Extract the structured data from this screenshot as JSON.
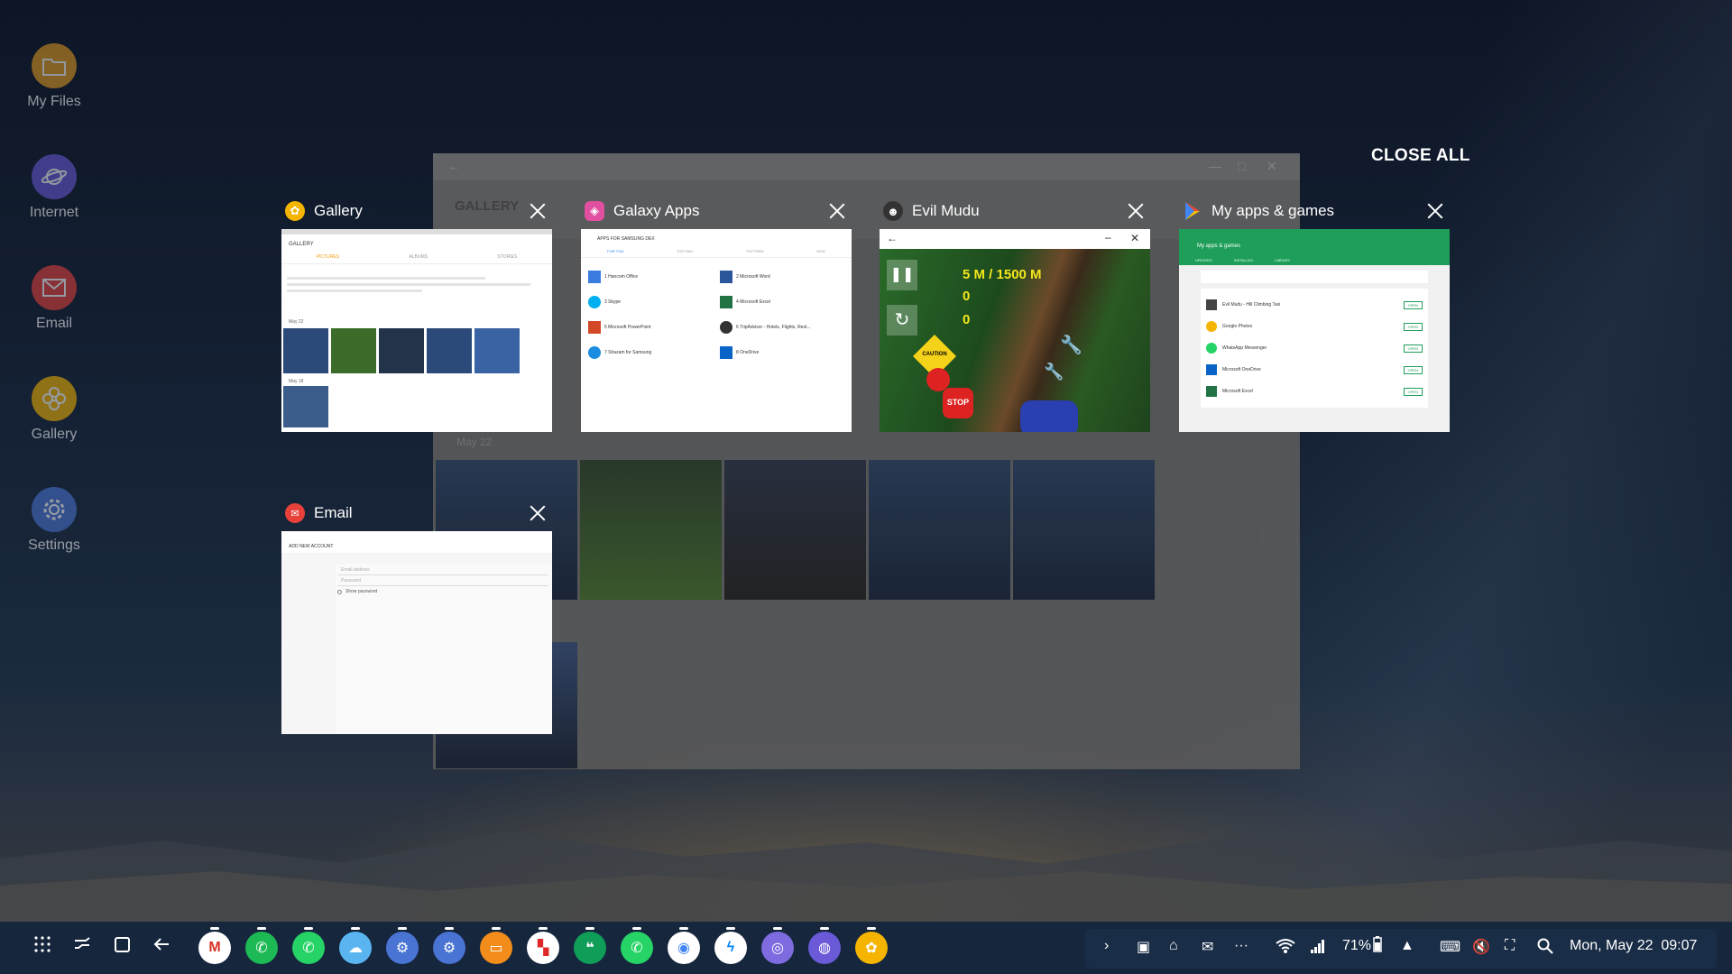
{
  "desktop": {
    "icons": [
      {
        "label": "My Files",
        "icon": "folder-icon",
        "color": "#e39b22"
      },
      {
        "label": "Internet",
        "icon": "planet-icon",
        "color": "#6a5ad8"
      },
      {
        "label": "Email",
        "icon": "envelope-icon",
        "color": "#e8413a"
      },
      {
        "label": "Gallery",
        "icon": "flower-icon",
        "color": "#f4b400"
      },
      {
        "label": "Settings",
        "icon": "gear-icon",
        "color": "#4a74d4"
      }
    ]
  },
  "background_window": {
    "title": "GALLERY",
    "date": "May 22"
  },
  "recents": {
    "close_all_label": "CLOSE ALL",
    "cards": [
      {
        "title": "Gallery",
        "icon": "gallery-icon",
        "color": "#f4b400"
      },
      {
        "title": "Galaxy Apps",
        "icon": "galaxy-apps-icon",
        "color": "#e04fa0"
      },
      {
        "title": "Evil Mudu",
        "icon": "evil-mudu-icon",
        "color": "#333333"
      },
      {
        "title": "My apps & games",
        "icon": "play-store-icon",
        "color": "#ffffff"
      },
      {
        "title": "Email",
        "icon": "email-icon",
        "color": "#e8413a"
      }
    ],
    "gallery_thumb": {
      "header": "GALLERY",
      "tabs": [
        "PICTURES",
        "ALBUMS",
        "STORIES"
      ],
      "date1": "May 22",
      "date2": "May 18"
    },
    "galaxy_thumb": {
      "header": "APPS FOR SAMSUNG DEX",
      "tabs": [
        "FOR YOU",
        "TOP PAID",
        "TOP FREE",
        "NEW"
      ],
      "apps": [
        "1 Hancom Office",
        "2 Microsoft Word",
        "3 Skype",
        "4 Microsoft Excel",
        "5 Microsoft PowerPoint",
        "6 TripAdvisor - Hotels, Flights, Rest...",
        "7 Shazam for Samsung",
        "8 OneDrive"
      ]
    },
    "game_thumb": {
      "distance": "5 M / 1500 M",
      "count1": "0",
      "count2": "0",
      "sign1": "CAUTION",
      "sign2": "STOP"
    },
    "play_thumb": {
      "header": "My apps & games",
      "tabs": [
        "UPDATES",
        "INSTALLED",
        "LIBRARY"
      ],
      "apps": [
        "Evil Mudu - Hill Climbing Taxi",
        "Google Photos",
        "WhatsApp Messenger",
        "Microsoft OneDrive",
        "Microsoft Excel"
      ],
      "open_label": "OPEN"
    },
    "email_thumb": {
      "header": "ADD NEW ACCOUNT",
      "email_placeholder": "Email address",
      "password_placeholder": "Password",
      "show_password": "Show password"
    }
  },
  "taskbar": {
    "apps": [
      {
        "name": "gmail",
        "glyph": "M",
        "color": "#ffffff",
        "fg": "#d93025"
      },
      {
        "name": "phone",
        "glyph": "✆",
        "color": "#1db954",
        "fg": "#ffffff"
      },
      {
        "name": "whatsapp",
        "glyph": "✆",
        "color": "#25d366",
        "fg": "#ffffff"
      },
      {
        "name": "weather",
        "glyph": "☁",
        "color": "#5ab4f0",
        "fg": "#ffffff"
      },
      {
        "name": "settings",
        "glyph": "⚙",
        "color": "#4a74d4",
        "fg": "#ffffff"
      },
      {
        "name": "settings-2",
        "glyph": "⚙",
        "color": "#4a74d4",
        "fg": "#ffffff"
      },
      {
        "name": "slides",
        "glyph": "▭",
        "color": "#f28c1a",
        "fg": "#ffffff"
      },
      {
        "name": "flipboard",
        "glyph": "▚",
        "color": "#ffffff",
        "fg": "#e12828"
      },
      {
        "name": "hangouts",
        "glyph": "❝",
        "color": "#0f9d58",
        "fg": "#ffffff"
      },
      {
        "name": "whatsapp-2",
        "glyph": "✆",
        "color": "#25d366",
        "fg": "#ffffff"
      },
      {
        "name": "chrome",
        "glyph": "◉",
        "color": "#ffffff",
        "fg": "#4285f4"
      },
      {
        "name": "messenger",
        "glyph": "ϟ",
        "color": "#ffffff",
        "fg": "#0084ff"
      },
      {
        "name": "camera",
        "glyph": "◎",
        "color": "#7e6be0",
        "fg": "#ffffff"
      },
      {
        "name": "internet",
        "glyph": "◍",
        "color": "#6a5ad8",
        "fg": "#ffffff"
      },
      {
        "name": "gallery",
        "glyph": "✿",
        "color": "#f4b400",
        "fg": "#ffffff"
      }
    ],
    "battery": "71%",
    "datetime": "Mon, May 22  09:07"
  }
}
